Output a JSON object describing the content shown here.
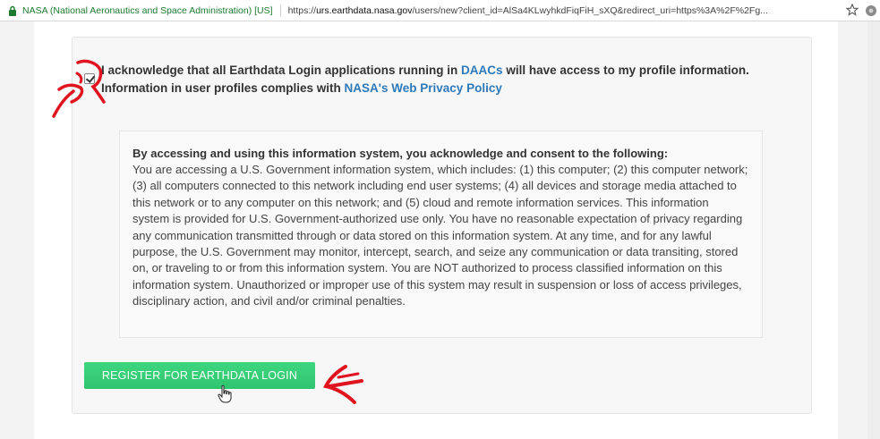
{
  "browser": {
    "site_identity": "NASA (National Aeronautics and Space Administration) [US]",
    "url_prefix": "https://",
    "url_host": "urs.earthdata.nasa.gov",
    "url_rest": "/users/new?client_id=AlSa4KLwyhkdFiqFiH_sXQ&redirect_uri=https%3A%2F%2Fg...",
    "icons": [
      "lock-icon",
      "star-icon",
      "extension-icon"
    ]
  },
  "acknowledgement": {
    "text_part1": "I acknowledge that all Earthdata Login applications running in ",
    "link1": "DAACs",
    "text_part2": " will have access to my profile information. Information in user profiles complies with ",
    "link2": "NASA's Web Privacy Policy",
    "checked": true
  },
  "notice": {
    "title": "By accessing and using this information system, you acknowledge and consent to the following:",
    "body": "You are accessing a U.S. Government information system, which includes: (1) this computer; (2) this computer network; (3) all computers connected to this network including end user systems; (4) all devices and storage media attached to this network or to any computer on this network; and (5) cloud and remote information services. This information system is provided for U.S. Government-authorized use only. You have no reasonable expectation of privacy regarding any communication transmitted through or data stored on this information system. At any time, and for any lawful purpose, the U.S. Government may monitor, intercept, search, and seize any communication or data transiting, stored on, or traveling to or from this information system. You are NOT authorized to process classified information on this information system. Unauthorized or improper use of this system may result in suspension or loss of access privileges, disciplinary action, and civil and/or criminal penalties."
  },
  "register_button": {
    "label": "REGISTER FOR EARTHDATA LOGIN"
  },
  "colors": {
    "button_green": "#2fc56e",
    "link_blue": "#2f79b9",
    "annotation_red": "#e0141e",
    "secure_green": "#1b7a2e"
  }
}
